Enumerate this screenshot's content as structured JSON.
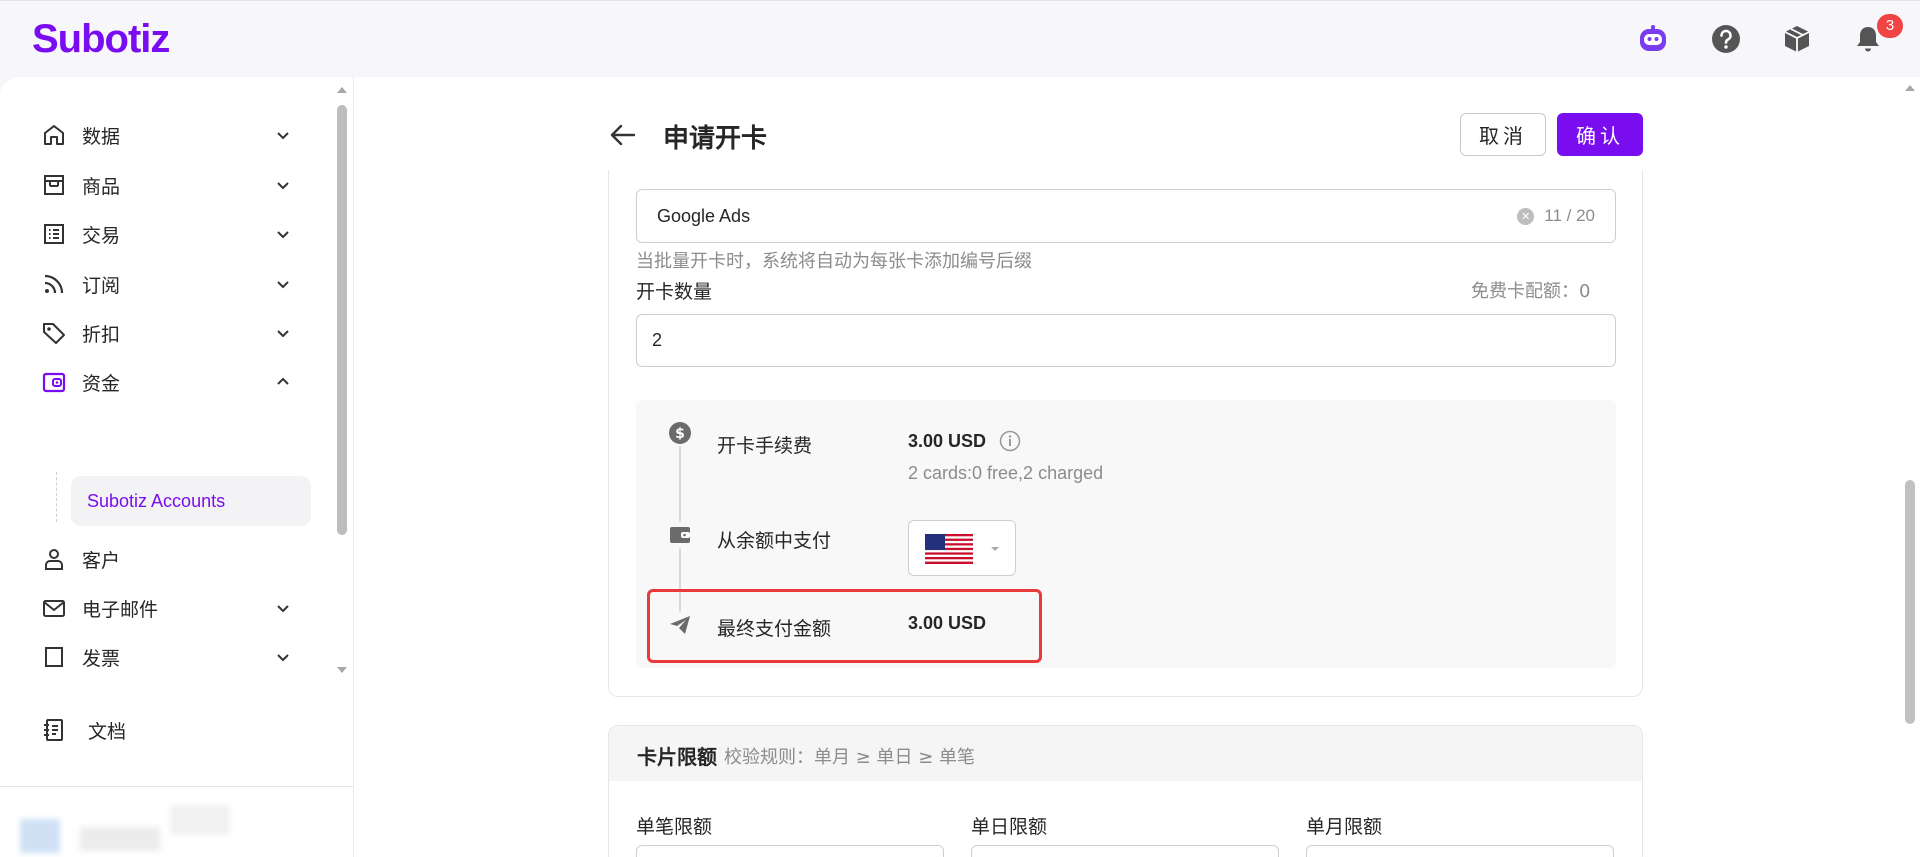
{
  "app": {
    "logo": "Subotiz",
    "notification_count": "3"
  },
  "sidebar": {
    "items": [
      {
        "label": "数据",
        "icon": "home-icon",
        "expanded": false
      },
      {
        "label": "商品",
        "icon": "store-icon",
        "expanded": false
      },
      {
        "label": "交易",
        "icon": "list-icon",
        "expanded": false
      },
      {
        "label": "订阅",
        "icon": "rss-icon",
        "expanded": false
      },
      {
        "label": "折扣",
        "icon": "tag-icon",
        "expanded": false
      },
      {
        "label": "资金",
        "icon": "wallet-icon",
        "expanded": true
      },
      {
        "label": "客户",
        "icon": "user-icon",
        "expanded": false
      },
      {
        "label": "电子邮件",
        "icon": "mail-icon",
        "expanded": false
      },
      {
        "label": "发票",
        "icon": "invoice-icon",
        "expanded": false
      }
    ],
    "sub_item": "Subotiz Accounts",
    "docs": "文档"
  },
  "header": {
    "title": "申请开卡",
    "cancel_label": "取消",
    "confirm_label": "确认"
  },
  "form": {
    "card_name_value": "Google Ads",
    "card_name_count": "11 / 20",
    "hint": "当批量开卡时，系统将自动为每张卡添加编号后缀",
    "quantity_label": "开卡数量",
    "free_quota": "免费卡配额：0",
    "quantity_value": "2"
  },
  "summary": {
    "fee_label": "开卡手续费",
    "fee_value": "3.00 USD",
    "fee_detail": "2 cards:0 free,2 charged",
    "pay_from_label": "从余额中支付",
    "currency_flag": "us-flag-icon",
    "final_label": "最终支付金额",
    "final_value": "3.00 USD"
  },
  "limits": {
    "title": "卡片限额",
    "rule": "校验规则：单月 ≥ 单日 ≥ 单笔",
    "per_txn": "单笔限额",
    "daily": "单日限额",
    "monthly": "单月限额"
  },
  "colors": {
    "brand": "#7a0cf0",
    "highlight": "#e83a3a",
    "badge": "#f04343"
  }
}
